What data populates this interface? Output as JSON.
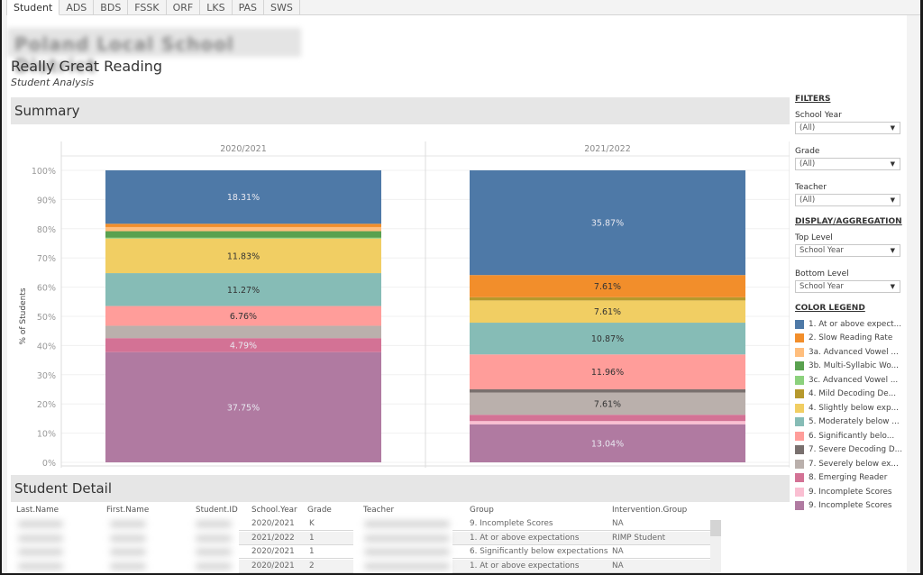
{
  "tabs": [
    {
      "label": "Student",
      "active": true
    },
    {
      "label": "ADS",
      "active": false
    },
    {
      "label": "BDS",
      "active": false
    },
    {
      "label": "FSSK",
      "active": false
    },
    {
      "label": "ORF",
      "active": false
    },
    {
      "label": "LKS",
      "active": false
    },
    {
      "label": "PAS",
      "active": false
    },
    {
      "label": "SWS",
      "active": false
    }
  ],
  "header": {
    "district": "Poland Local School District",
    "title": "Really Great Reading",
    "subtitle": "Student Analysis"
  },
  "summary": {
    "title": "Summary"
  },
  "detail": {
    "title": "Student Detail",
    "columns": [
      "Last.Name",
      "First.Name",
      "Student.ID",
      "School.Year",
      "Grade",
      "Teacher",
      "Group",
      "Intervention.Group"
    ],
    "rows": [
      {
        "school_year": "2020/2021",
        "grade": "K",
        "group": "9. Incomplete Scores",
        "intervention": "NA"
      },
      {
        "school_year": "2021/2022",
        "grade": "1",
        "group": "1. At or above expectations",
        "intervention": "RIMP Student"
      },
      {
        "school_year": "2020/2021",
        "grade": "1",
        "group": "6. Significantly below expectations",
        "intervention": "NA"
      },
      {
        "school_year": "2020/2021",
        "grade": "2",
        "group": "1. At or above expectations",
        "intervention": "NA"
      }
    ]
  },
  "filters": {
    "heading": "FILTERS",
    "school_year": {
      "label": "School Year",
      "value": "(All)"
    },
    "grade": {
      "label": "Grade",
      "value": "(All)"
    },
    "teacher": {
      "label": "Teacher",
      "value": "(All)"
    }
  },
  "display": {
    "heading": "DISPLAY/AGGREGATION",
    "top_level": {
      "label": "Top Level",
      "value": "School Year"
    },
    "bottom_level": {
      "label": "Bottom Level",
      "value": "School Year"
    }
  },
  "legend": {
    "heading": "COLOR LEGEND",
    "items": [
      {
        "label": "1. At or above expect...",
        "color": "#4e79a7"
      },
      {
        "label": "2. Slow Reading Rate",
        "color": "#f28e2b"
      },
      {
        "label": "3a. Advanced Vowel ...",
        "color": "#ffbe7d"
      },
      {
        "label": "3b. Multi-Syllabic Wo...",
        "color": "#59a14f"
      },
      {
        "label": "3c. Advanced Vowel ...",
        "color": "#8cd17d"
      },
      {
        "label": "4. Mild Decoding De...",
        "color": "#b6992d"
      },
      {
        "label": "4. Slightly below exp...",
        "color": "#f1ce63"
      },
      {
        "label": "5. Moderately below ...",
        "color": "#86bcb6"
      },
      {
        "label": "6. Significantly belo...",
        "color": "#ff9d9a"
      },
      {
        "label": "7. Severe Decoding D...",
        "color": "#79706e"
      },
      {
        "label": "7. Severely below ex...",
        "color": "#bab0ac"
      },
      {
        "label": "8. Emerging Reader",
        "color": "#d37295"
      },
      {
        "label": "9. Incomplete Scores",
        "color": "#fabfd2"
      },
      {
        "label": "9. Incomplete Scores",
        "color": "#b07aa1"
      }
    ]
  },
  "chart_data": {
    "type": "bar",
    "stacked": true,
    "title": "Summary",
    "xlabel": "",
    "ylabel": "% of Students",
    "ylim": [
      0,
      100
    ],
    "yticks": [
      "0%",
      "10%",
      "20%",
      "30%",
      "40%",
      "50%",
      "60%",
      "70%",
      "80%",
      "90%",
      "100%"
    ],
    "grid": true,
    "legend_position": "right",
    "categories": [
      "2020/2021",
      "2021/2022"
    ],
    "series": [
      {
        "name": "9. Incomplete Scores (purple)",
        "color": "#b07aa1",
        "values": [
          37.75,
          13.04
        ],
        "labels": [
          "37.75%",
          "13.04%"
        ]
      },
      {
        "name": "9. Incomplete Scores (pink)",
        "color": "#fabfd2",
        "values": [
          0,
          1.09
        ],
        "labels": [
          "",
          ""
        ]
      },
      {
        "name": "8. Emerging Reader",
        "color": "#d37295",
        "values": [
          4.79,
          2.17
        ],
        "labels": [
          "4.79%",
          ""
        ]
      },
      {
        "name": "7. Severely below expectations",
        "color": "#bab0ac",
        "values": [
          4.23,
          7.61
        ],
        "labels": [
          "",
          "7.61%"
        ]
      },
      {
        "name": "7. Severe Decoding Deficit",
        "color": "#79706e",
        "values": [
          0,
          1.09
        ],
        "labels": [
          "",
          ""
        ]
      },
      {
        "name": "6. Significantly below expectations",
        "color": "#ff9d9a",
        "values": [
          6.76,
          11.96
        ],
        "labels": [
          "6.76%",
          "11.96%"
        ]
      },
      {
        "name": "5. Moderately below expectations",
        "color": "#86bcb6",
        "values": [
          11.27,
          10.87
        ],
        "labels": [
          "11.27%",
          "10.87%"
        ]
      },
      {
        "name": "4. Slightly below expectations",
        "color": "#f1ce63",
        "values": [
          11.83,
          7.61
        ],
        "labels": [
          "11.83%",
          "7.61%"
        ]
      },
      {
        "name": "4. Mild Decoding Deficit",
        "color": "#b6992d",
        "values": [
          0,
          1.09
        ],
        "labels": [
          "",
          ""
        ]
      },
      {
        "name": "3c. Advanced Vowel",
        "color": "#8cd17d",
        "values": [
          0.28,
          0
        ],
        "labels": [
          "",
          ""
        ]
      },
      {
        "name": "3b. Multi-Syllabic Words",
        "color": "#59a14f",
        "values": [
          2.25,
          0
        ],
        "labels": [
          "",
          ""
        ]
      },
      {
        "name": "3a. Advanced Vowel",
        "color": "#ffbe7d",
        "values": [
          1.41,
          0
        ],
        "labels": [
          "",
          ""
        ]
      },
      {
        "name": "2. Slow Reading Rate",
        "color": "#f28e2b",
        "values": [
          1.13,
          7.61
        ],
        "labels": [
          "",
          "7.61%"
        ]
      },
      {
        "name": "1. At or above expectations",
        "color": "#4e79a7",
        "values": [
          18.31,
          35.87
        ],
        "labels": [
          "18.31%",
          "35.87%"
        ]
      }
    ]
  }
}
